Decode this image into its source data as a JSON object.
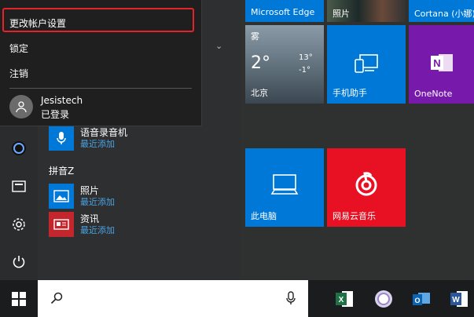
{
  "tiles": {
    "edge_label": "Microsoft Edge",
    "photos_strip_label": "照片",
    "cortana_label": "Cortana (小娜)",
    "weather": {
      "condition": "雾",
      "temp": "2°",
      "high": "13°",
      "low": "-1°",
      "city": "北京"
    },
    "phone_label": "手机助手",
    "onenote_label": "OneNote",
    "pc_label": "此电脑",
    "music_label": "网易云音乐"
  },
  "popup": {
    "change_settings": "更改帐户设置",
    "lock": "锁定",
    "sign_out": "注销",
    "user_name": "Jesistech",
    "user_status": "已登录"
  },
  "apps": {
    "recorder_name": "语音录音机",
    "recorder_sub": "最近添加",
    "letter_z": "拼音Z",
    "photos_name": "照片",
    "photos_sub": "最近添加",
    "news_name": "资讯",
    "news_sub": "最近添加"
  },
  "colors": {
    "accent": "#0078d7",
    "onenote": "#7719aa",
    "music": "#e81123",
    "highlight": "#e2232a"
  }
}
